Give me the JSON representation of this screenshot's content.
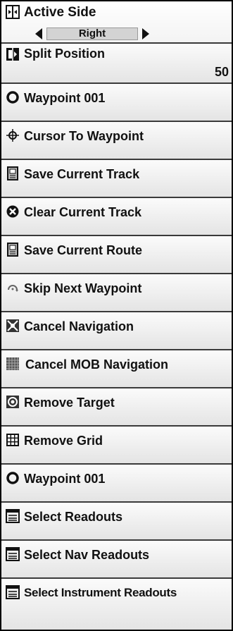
{
  "menu": {
    "items": [
      {
        "label": "Active Side",
        "icon": "split-screen-icon",
        "value": "Right"
      },
      {
        "label": "Split Position",
        "icon": "split-position-icon",
        "value": "50"
      },
      {
        "label": "Waypoint 001",
        "icon": "waypoint-icon"
      },
      {
        "label": "Cursor To Waypoint",
        "icon": "crosshair-icon"
      },
      {
        "label": "Save Current Track",
        "icon": "save-track-icon"
      },
      {
        "label": "Clear Current Track",
        "icon": "clear-icon"
      },
      {
        "label": "Save Current Route",
        "icon": "save-route-icon"
      },
      {
        "label": "Skip Next Waypoint",
        "icon": "skip-icon"
      },
      {
        "label": "Cancel Navigation",
        "icon": "cancel-navigation-icon"
      },
      {
        "label": "Cancel MOB Navigation",
        "icon": "cancel-mob-icon"
      },
      {
        "label": "Remove Target",
        "icon": "target-icon"
      },
      {
        "label": "Remove Grid",
        "icon": "grid-icon"
      },
      {
        "label": "Waypoint 001",
        "icon": "waypoint-icon"
      },
      {
        "label": "Select Readouts",
        "icon": "readouts-icon"
      },
      {
        "label": "Select Nav Readouts",
        "icon": "nav-readouts-icon"
      },
      {
        "label": "Select Instrument Readouts",
        "icon": "instrument-readouts-icon"
      }
    ]
  }
}
